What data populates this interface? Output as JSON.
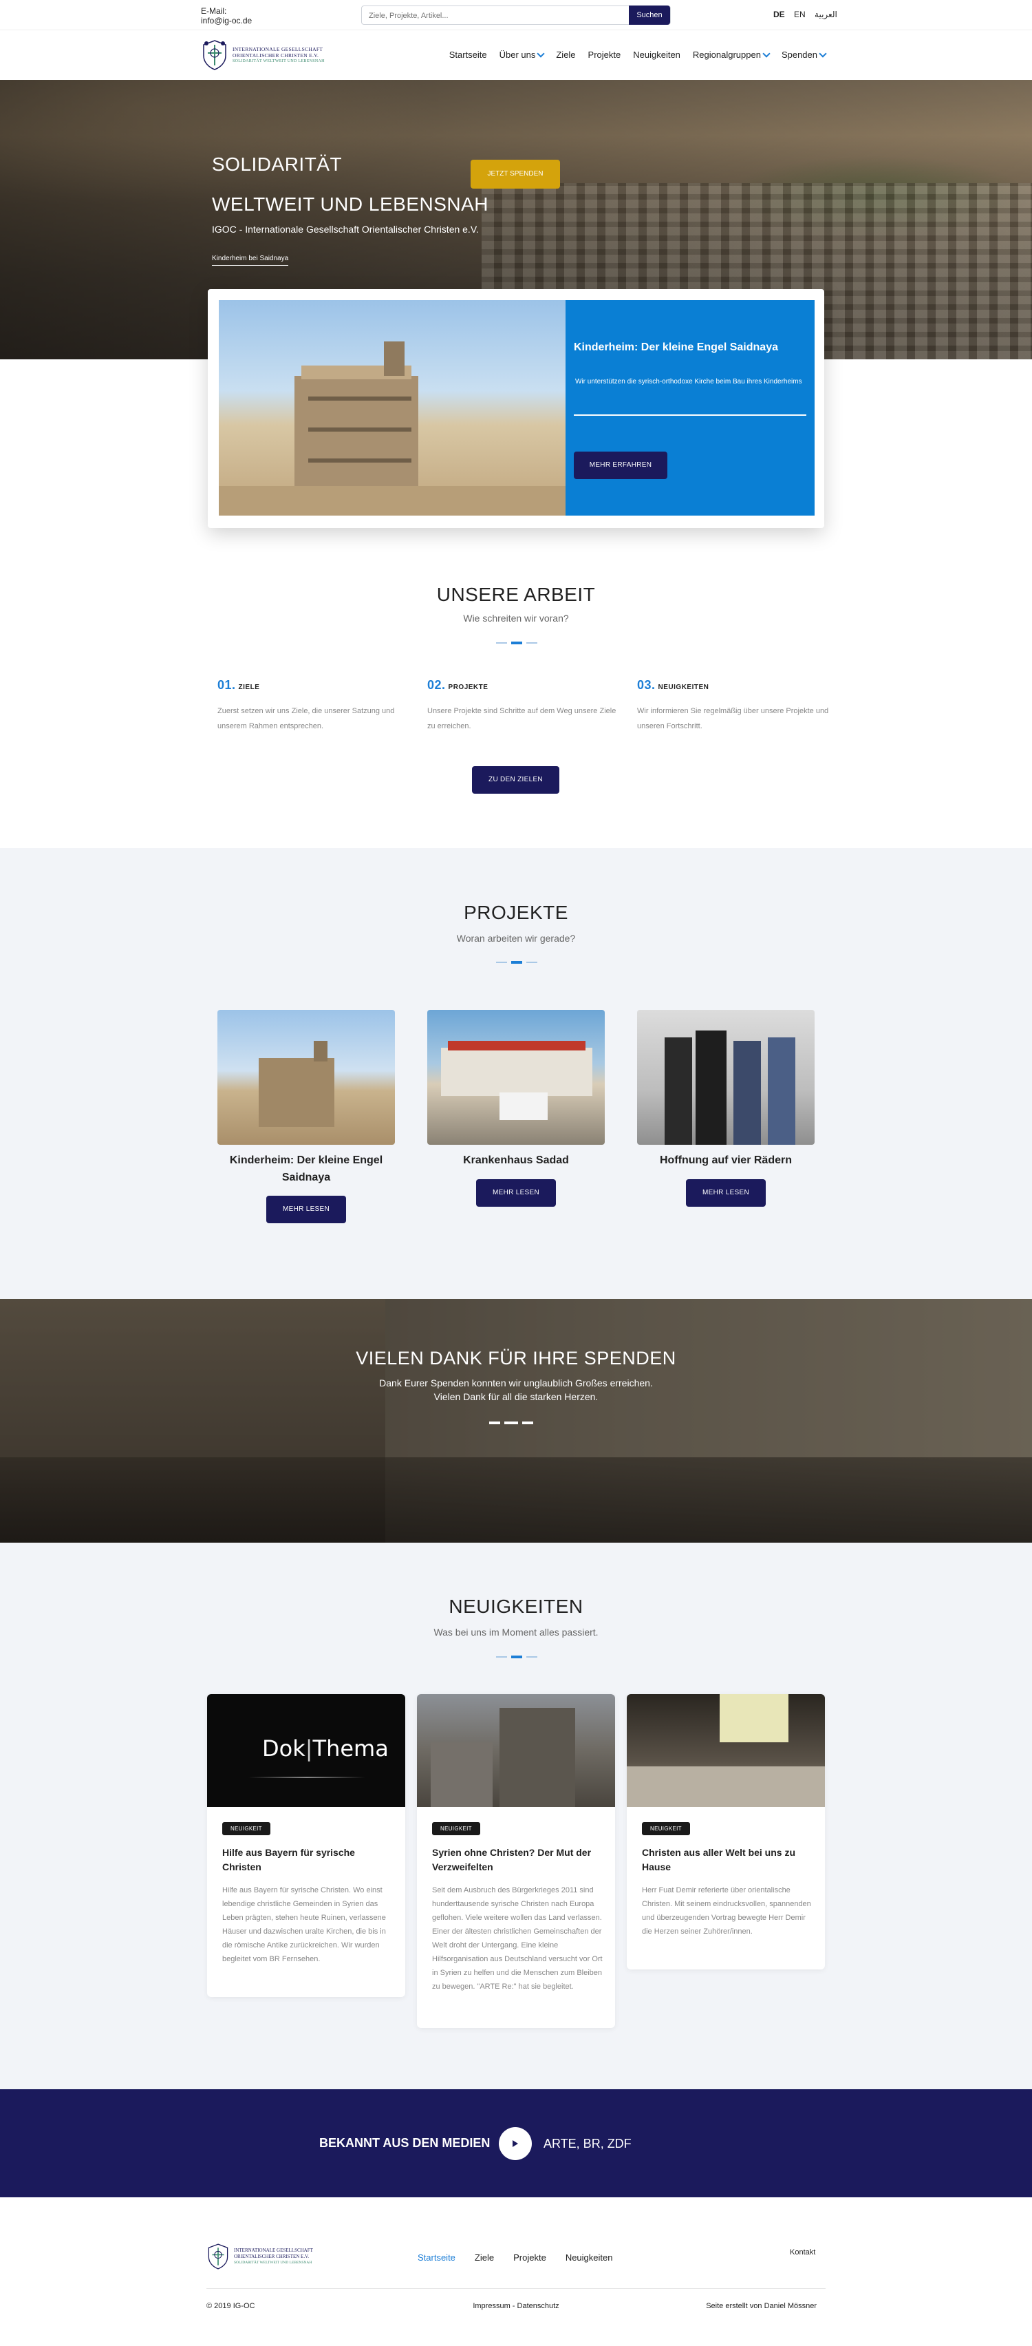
{
  "topbar": {
    "email_label": "E-Mail:",
    "email": "info@ig-oc.de",
    "search_placeholder": "Ziele, Projekte, Artikel...",
    "search_button": "Suchen",
    "langs": [
      "DE",
      "EN",
      "العربية"
    ]
  },
  "logo": {
    "line1": "INTERNATIONALE GESELLSCHAFT",
    "line2": "ORIENTALISCHER CHRISTEN E.V.",
    "line3": "SOLIDARITÄT WELTWEIT UND LEBENSNAH"
  },
  "nav": {
    "items": [
      "Startseite",
      "Über uns",
      "Ziele",
      "Projekte",
      "Neuigkeiten",
      "Regionalgruppen",
      "Spenden"
    ]
  },
  "hero": {
    "line1": "SOLIDARITÄT",
    "line2": "WELTWEIT UND LEBENSNAH",
    "subtitle": "IGOC - Internationale Gesellschaft Orientalischer Christen e.V.",
    "caption": "Kinderheim bei Saidnaya"
  },
  "feature": {
    "title": "Kinderheim: Der kleine Engel Saidnaya",
    "text": "Wir unterstützen die syrisch-orthodoxe Kirche beim Bau ihres Kinderheims",
    "button": "MEHR ERFAHREN"
  },
  "work": {
    "title": "UNSERE ARBEIT",
    "subtitle": "Wie schreiten wir voran?",
    "columns": [
      {
        "num": "01.",
        "label": "ZIELE",
        "text": "Zuerst setzen wir uns Ziele, die unserer Satzung und unserem Rahmen entsprechen."
      },
      {
        "num": "02.",
        "label": "PROJEKTE",
        "text": "Unsere Projekte sind Schritte auf dem Weg unsere Ziele zu erreichen."
      },
      {
        "num": "03.",
        "label": "NEUIGKEITEN",
        "text": "Wir informieren Sie regelmäßig über unsere Projekte und unseren Fortschritt."
      }
    ],
    "button": "ZU DEN ZIELEN"
  },
  "projects": {
    "title": "PROJEKTE",
    "subtitle": "Woran arbeiten wir gerade?",
    "items": [
      {
        "title": "Kinderheim: Der kleine Engel Saidnaya",
        "button": "MEHR LESEN"
      },
      {
        "title": "Krankenhaus Sadad",
        "button": "MEHR LESEN"
      },
      {
        "title": "Hoffnung auf vier Rädern",
        "button": "MEHR LESEN"
      }
    ]
  },
  "donate": {
    "title": "VIELEN DANK FÜR IHRE SPENDEN",
    "line1": "Dank Eurer Spenden konnten wir unglaublich Großes erreichen.",
    "line2": "Vielen Dank für all die starken Herzen.",
    "button": "JETZT SPENDEN"
  },
  "news": {
    "title": "NEUIGKEITEN",
    "subtitle": "Was bei uns im Moment alles passiert.",
    "items": [
      {
        "badge": "NEUIGKEIT",
        "title": "Hilfe aus Bayern für syrische Christen",
        "text": "Hilfe aus Bayern für syrische Christen. Wo einst lebendige christliche Gemeinden in Syrien das Leben prägten, stehen heute Ruinen, verlassene Häuser und dazwischen uralte Kirchen, die bis in die römische Antike zurückreichen. Wir wurden begleitet vom BR Fernsehen.",
        "image_text_1": "Dok",
        "image_text_2": "Thema"
      },
      {
        "badge": "NEUIGKEIT",
        "title": "Syrien ohne Christen? Der Mut der Verzweifelten",
        "text": "Seit dem Ausbruch des Bürgerkrieges 2011 sind hunderttausende syrische Christen nach Europa geflohen. Viele weitere wollen das Land verlassen. Einer der ältesten christlichen Gemeinschaften der Welt droht der Untergang. Eine kleine Hilfsorganisation aus Deutschland versucht vor Ort in Syrien zu helfen und die Menschen zum Bleiben zu bewegen. \"ARTE Re:\" hat sie begleitet."
      },
      {
        "badge": "NEUIGKEIT",
        "title": "Christen aus aller Welt bei uns zu Hause",
        "text": "Herr Fuat Demir referierte über orientalische Christen. Mit seinem eindrucksvollen, spannenden und überzeugenden Vortrag bewegte Herr Demir die Herzen seiner Zuhörer/innen."
      }
    ]
  },
  "media": {
    "label": "BEKANNT AUS DEN MEDIEN",
    "value": "ARTE, BR, ZDF"
  },
  "footer": {
    "menu": [
      "Startseite",
      "Ziele",
      "Projekte",
      "Neuigkeiten"
    ],
    "kontakt": "Kontakt",
    "copyright": "© 2019 IG-OC",
    "legal": "Impressum - Datenschutz",
    "credit": "Seite erstellt von Daniel Mössner"
  },
  "colors": {
    "navy": "#1b1a5c",
    "accent_blue": "#0a7fd4",
    "link_blue": "#1c7ed6",
    "yellow": "#d4a30c",
    "light_bg": "#f2f4f8"
  },
  "icons": [
    "chevron-down-icon",
    "play-icon",
    "crest-logo"
  ]
}
